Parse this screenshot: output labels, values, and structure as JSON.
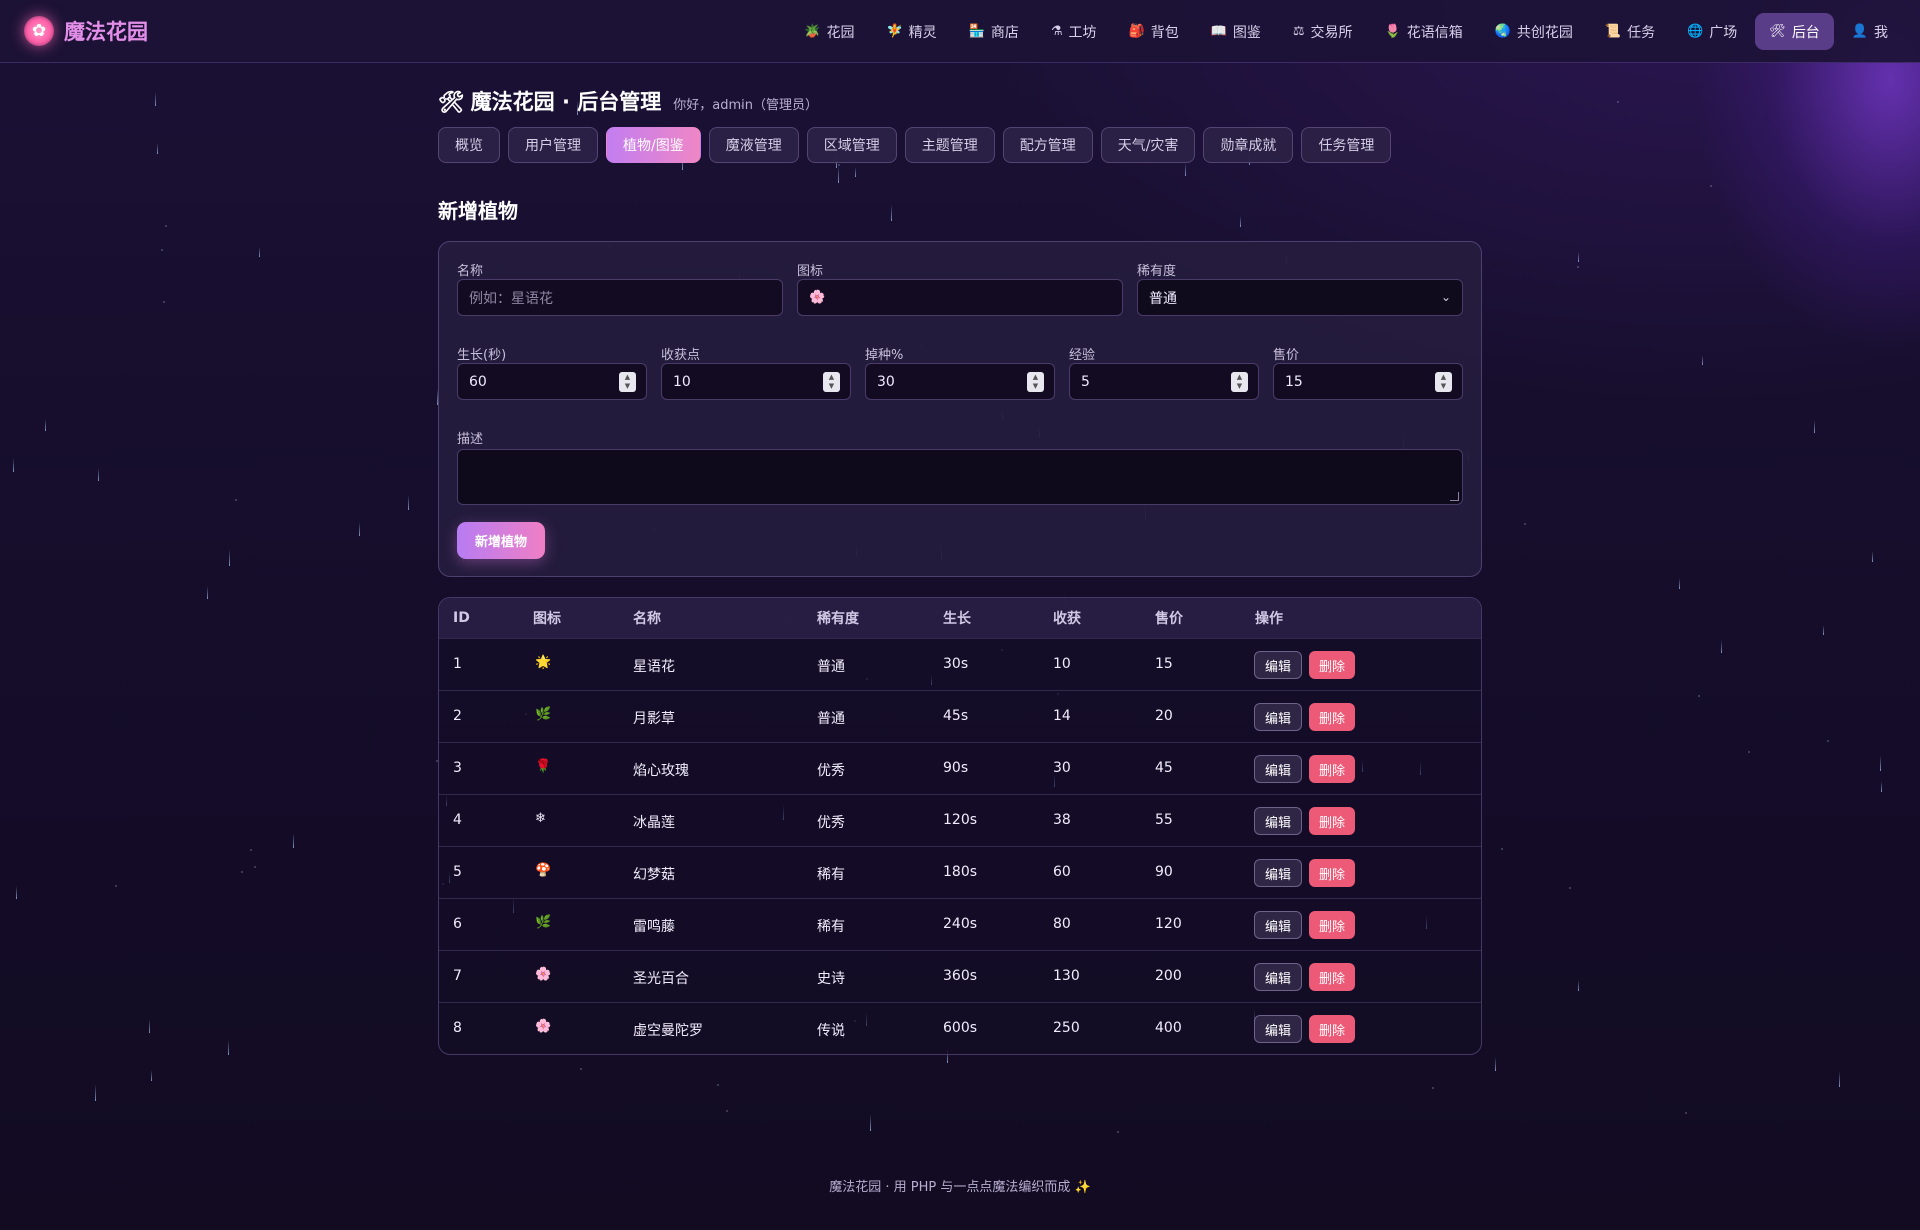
{
  "app": {
    "brand_name": "魔法花园",
    "brand_icon": "flower-logo-icon"
  },
  "nav": {
    "items": [
      {
        "icon": "🪴",
        "label": "花园"
      },
      {
        "icon": "🧚",
        "label": "精灵"
      },
      {
        "icon": "🏪",
        "label": "商店"
      },
      {
        "icon": "⚗",
        "label": "工坊"
      },
      {
        "icon": "🎒",
        "label": "背包"
      },
      {
        "icon": "📖",
        "label": "图鉴"
      },
      {
        "icon": "⚖",
        "label": "交易所"
      },
      {
        "icon": "🌷",
        "label": "花语信箱"
      },
      {
        "icon": "🌏",
        "label": "共创花园"
      },
      {
        "icon": "📜",
        "label": "任务"
      },
      {
        "icon": "🌐",
        "label": "广场"
      },
      {
        "icon": "🛠",
        "label": "后台",
        "active": true
      },
      {
        "icon": "👤",
        "label": "我"
      }
    ]
  },
  "header": {
    "title_icon": "🛠",
    "title": "魔法花园 · 后台管理",
    "greeting": "你好，admin（管理员）"
  },
  "tabs": [
    "概览",
    "用户管理",
    "植物/图鉴",
    "魔液管理",
    "区域管理",
    "主题管理",
    "配方管理",
    "天气/灾害",
    "勋章成就",
    "任务管理"
  ],
  "active_tab": "植物/图鉴",
  "form": {
    "section_title": "新增植物",
    "name_label": "名称",
    "name_placeholder": "例如：星语花",
    "icon_label": "图标",
    "icon_value": "🌸",
    "rarity_label": "稀有度",
    "rarity_value": "普通",
    "growth_label": "生长(秒)",
    "growth_value": "60",
    "harvest_label": "收获点",
    "harvest_value": "10",
    "drop_label": "掉种%",
    "drop_value": "30",
    "exp_label": "经验",
    "exp_value": "5",
    "price_label": "售价",
    "price_value": "15",
    "desc_label": "描述",
    "submit_label": "新增植物"
  },
  "table": {
    "headers": [
      "ID",
      "图标",
      "名称",
      "稀有度",
      "生长",
      "收获",
      "售价",
      "操作"
    ],
    "edit_label": "编辑",
    "delete_label": "删除",
    "rows": [
      {
        "id": "1",
        "icon": "🌟",
        "name": "星语花",
        "rarity": "普通",
        "growth": "30s",
        "harvest": "10",
        "price": "15"
      },
      {
        "id": "2",
        "icon": "🌿",
        "name": "月影草",
        "rarity": "普通",
        "growth": "45s",
        "harvest": "14",
        "price": "20"
      },
      {
        "id": "3",
        "icon": "🌹",
        "name": "焰心玫瑰",
        "rarity": "优秀",
        "growth": "90s",
        "harvest": "30",
        "price": "45"
      },
      {
        "id": "4",
        "icon": "❄",
        "name": "冰晶莲",
        "rarity": "优秀",
        "growth": "120s",
        "harvest": "38",
        "price": "55"
      },
      {
        "id": "5",
        "icon": "🍄",
        "name": "幻梦菇",
        "rarity": "稀有",
        "growth": "180s",
        "harvest": "60",
        "price": "90"
      },
      {
        "id": "6",
        "icon": "🌿",
        "name": "雷鸣藤",
        "rarity": "稀有",
        "growth": "240s",
        "harvest": "80",
        "price": "120"
      },
      {
        "id": "7",
        "icon": "🌸",
        "name": "圣光百合",
        "rarity": "史诗",
        "growth": "360s",
        "harvest": "130",
        "price": "200"
      },
      {
        "id": "8",
        "icon": "🌸",
        "name": "虚空曼陀罗",
        "rarity": "传说",
        "growth": "600s",
        "harvest": "250",
        "price": "400"
      }
    ]
  },
  "footer": "魔法花园 · 用 PHP 与一点点魔法编织而成 ✨",
  "colors": {
    "background": "#140d26",
    "accent_gradient_start": "#c27ef0",
    "accent_gradient_end": "#ef86c6",
    "delete_red": "#ec5a78",
    "brand_pink": "#e38ee8"
  }
}
